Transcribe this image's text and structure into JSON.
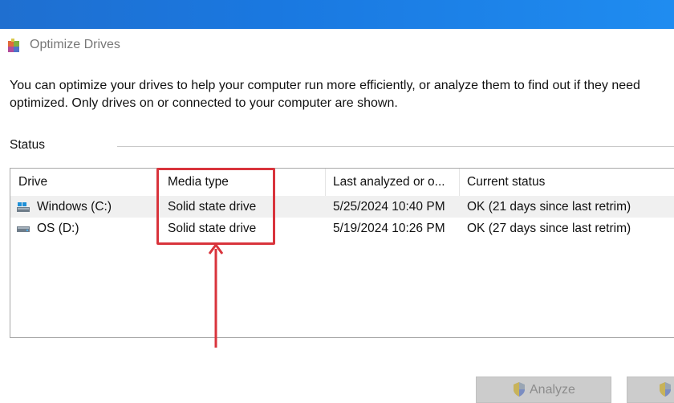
{
  "window": {
    "title": "Optimize Drives"
  },
  "description": {
    "line1": "You can optimize your drives to help your computer run more efficiently, or analyze them to find out if they need",
    "line2": "optimized. Only drives on or connected to your computer are shown."
  },
  "status": {
    "label": "Status"
  },
  "columns": {
    "drive": "Drive",
    "media_type": "Media type",
    "last_analyzed": "Last analyzed or o...",
    "current_status": "Current status"
  },
  "rows": [
    {
      "drive": "Windows (C:)",
      "drive_icon": "windows-drive-icon",
      "media_type": "Solid state drive",
      "last_analyzed": "5/25/2024 10:40 PM",
      "current_status": "OK (21 days since last retrim)"
    },
    {
      "drive": "OS (D:)",
      "drive_icon": "hard-drive-icon",
      "media_type": "Solid state drive",
      "last_analyzed": "5/19/2024 10:26 PM",
      "current_status": "OK (27 days since last retrim)"
    }
  ],
  "buttons": {
    "analyze": "Analyze"
  },
  "colors": {
    "annotation": "#d9343c",
    "row_highlight": "#f0f0f0",
    "button_disabled": "#cccccc"
  }
}
